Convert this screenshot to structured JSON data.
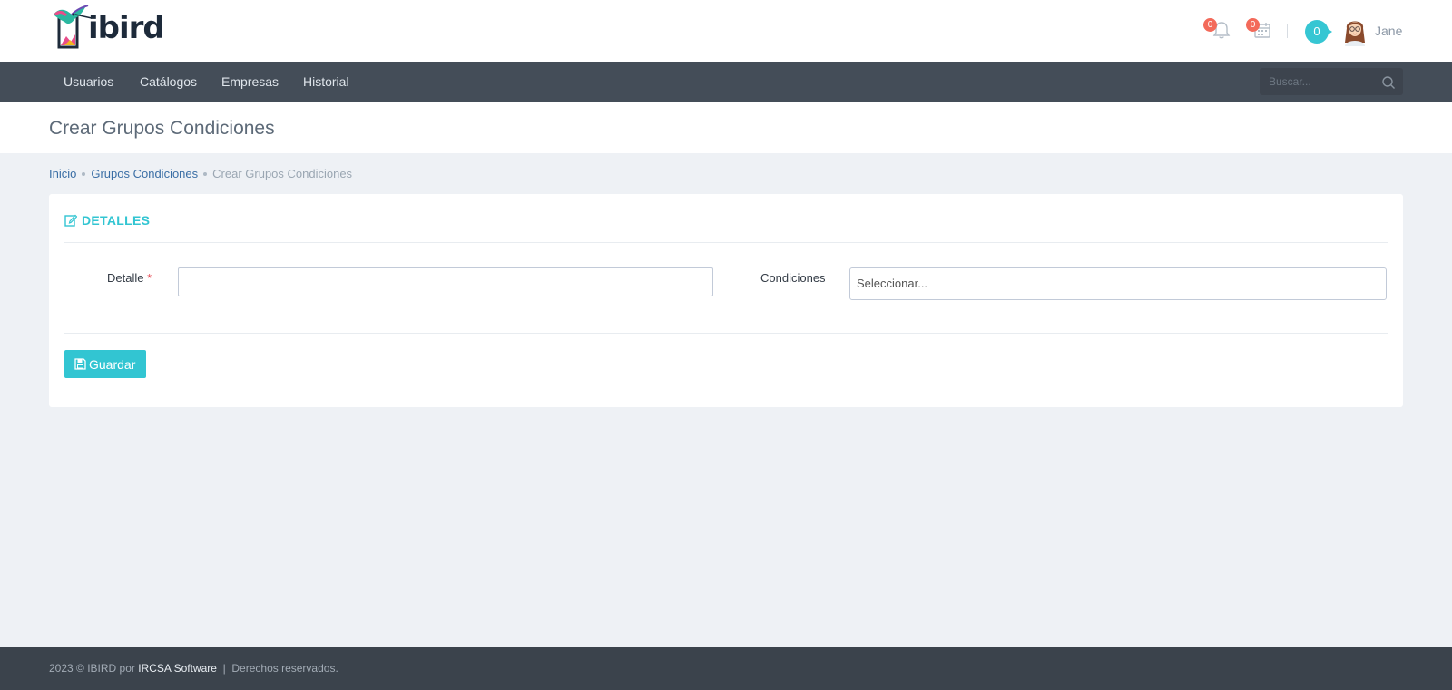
{
  "brand": {
    "logo_text": "ibird"
  },
  "header": {
    "notifications": {
      "icon": "bell-icon",
      "count": "0"
    },
    "calendar": {
      "icon": "calendar-icon",
      "count": "0"
    },
    "inbox_count": "0",
    "user": {
      "name": "Jane",
      "icon": "user-avatar"
    }
  },
  "nav": {
    "items": [
      {
        "label": "Usuarios"
      },
      {
        "label": "Catálogos"
      },
      {
        "label": "Empresas"
      },
      {
        "label": "Historial"
      }
    ],
    "search": {
      "placeholder": "Buscar...",
      "icon": "search-icon"
    }
  },
  "page": {
    "title": "Crear Grupos Condiciones"
  },
  "breadcrumb": {
    "items": [
      {
        "label": "Inicio"
      },
      {
        "label": "Grupos Condiciones"
      },
      {
        "label": "Crear Grupos Condiciones"
      }
    ]
  },
  "form": {
    "section_title": "DETALLES",
    "section_icon": "edit-icon",
    "detalle": {
      "label": "Detalle",
      "required_mark": "*",
      "value": ""
    },
    "condiciones": {
      "label": "Condiciones",
      "placeholder": "Seleccionar..."
    },
    "save_label": "Guardar",
    "save_icon": "floppy-disk-icon"
  },
  "footer": {
    "prefix": "2023 © IBIRD por ",
    "company": "IRCSA Software",
    "suffix": "  |  Derechos reservados."
  },
  "colors": {
    "accent": "#32c5d2",
    "navbar": "#444d58",
    "badge": "#f36a5a",
    "footer": "#3b434c"
  }
}
